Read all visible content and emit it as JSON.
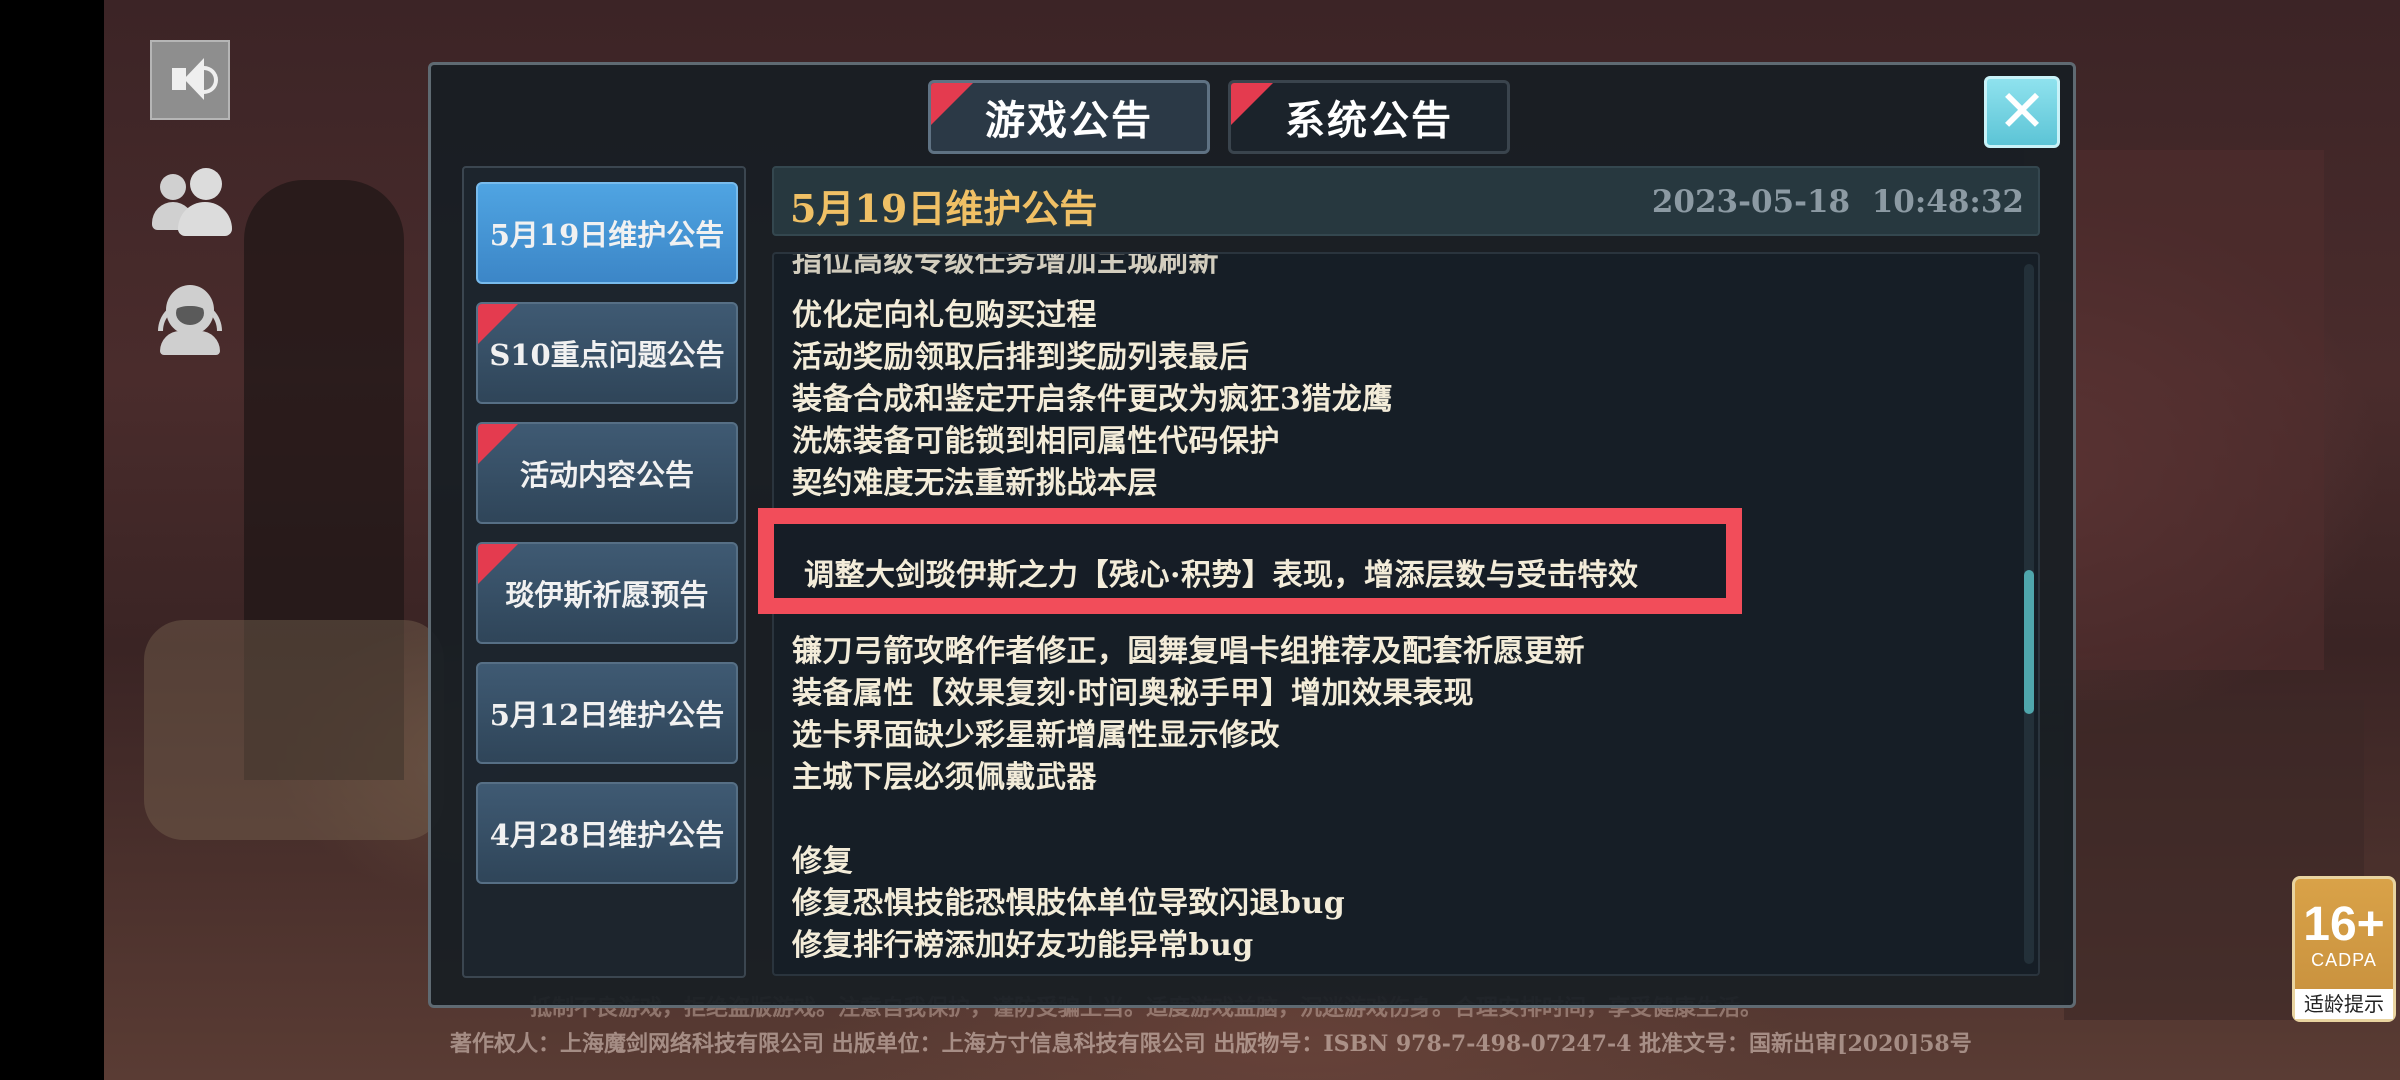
{
  "tabs": {
    "game": "游戏公告",
    "system": "系统公告"
  },
  "close_label": "✕",
  "sidebar": {
    "items": [
      {
        "label": "5月19日维护公告"
      },
      {
        "label": "S10重点问题公告"
      },
      {
        "label": "活动内容公告"
      },
      {
        "label": "琰伊斯祈愿预告"
      },
      {
        "label": "5月12日维护公告"
      },
      {
        "label": "4月28日维护公告"
      }
    ]
  },
  "notice": {
    "title": "5月19日维护公告",
    "timestamp": "2023-05-18  10:48:32",
    "lines": [
      "指位高级专级任务增加主城刷新",
      "优化定向礼包购买过程",
      "活动奖励领取后排到奖励列表最后",
      "装备合成和鉴定开启条件更改为疯狂3猎龙鹰",
      "洗炼装备可能锁到相同属性代码保护",
      "契约难度无法重新挑战本层",
      "调整大剑琰伊斯之力【残心·积势】表现，增添层数与受击特效",
      "镰刀弓箭攻略作者修正，圆舞复唱卡组推荐及配套祈愿更新",
      "装备属性【效果复刻·时间奥秘手甲】增加效果表现",
      "选卡界面缺少彩星新增属性显示修改",
      "主城下层必须佩戴武器",
      "",
      "修复",
      "修复恐惧技能恐惧肢体单位导致闪退bug",
      "修复排行榜添加好友功能异常bug"
    ]
  },
  "footer": {
    "line1": "抵制不良游戏，拒绝盗版游戏。注意自我保护，谨防受骗上当。适度游戏益脑，沉迷游戏伤身。合理安排时间，享受健康生活。",
    "line2": "著作权人：上海魔剑网络科技有限公司 出版单位：上海方寸信息科技有限公司 出版物号：ISBN 978-7-498-07247-4 批准文号：国新出审[2020]58号"
  },
  "age_rating": {
    "value": "16+",
    "org": "CADPA",
    "tip": "适龄提示"
  },
  "colors": {
    "accent_red": "#f24d5a",
    "title_gold": "#f0c065",
    "active_tab_blue": "#4fa4e2",
    "close_cyan": "#5cc4d6"
  }
}
